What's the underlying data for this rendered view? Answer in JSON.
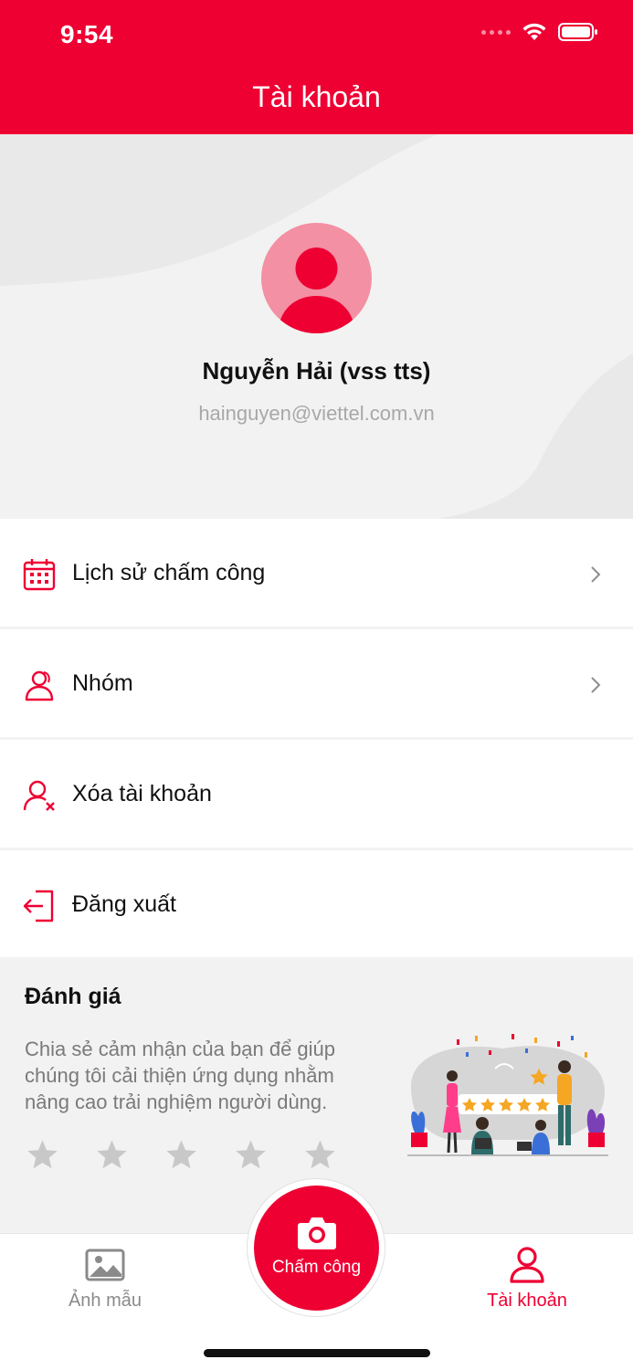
{
  "status_bar": {
    "time": "9:54"
  },
  "header": {
    "title": "Tài khoản"
  },
  "profile": {
    "name": "Nguyễn Hải (vss tts)",
    "email": "hainguyen@viettel.com.vn"
  },
  "menu": {
    "items": [
      {
        "label": "Lịch sử chấm công",
        "icon": "calendar-icon",
        "has_chevron": true
      },
      {
        "label": "Nhóm",
        "icon": "group-user-icon",
        "has_chevron": true
      },
      {
        "label": "Xóa tài khoản",
        "icon": "user-remove-icon",
        "has_chevron": false
      },
      {
        "label": "Đăng xuất",
        "icon": "logout-icon",
        "has_chevron": false
      }
    ]
  },
  "review": {
    "title": "Đánh giá",
    "description": "Chia sẻ cảm nhận của bạn để giúp chúng tôi cải thiện ứng dụng nhằm nâng cao trải nghiệm người dùng.",
    "rating": 0,
    "max_rating": 5
  },
  "tabbar": {
    "left": {
      "label": "Ảnh mẫu",
      "icon": "image-icon"
    },
    "center": {
      "label": "Chấm công",
      "icon": "camera-icon"
    },
    "right": {
      "label": "Tài khoản",
      "icon": "user-icon",
      "active": true
    }
  },
  "colors": {
    "brand": "#ee0033",
    "avatar_bg": "#f390a3",
    "inactive": "#8a8a8a",
    "star": "#c8c8c8"
  }
}
